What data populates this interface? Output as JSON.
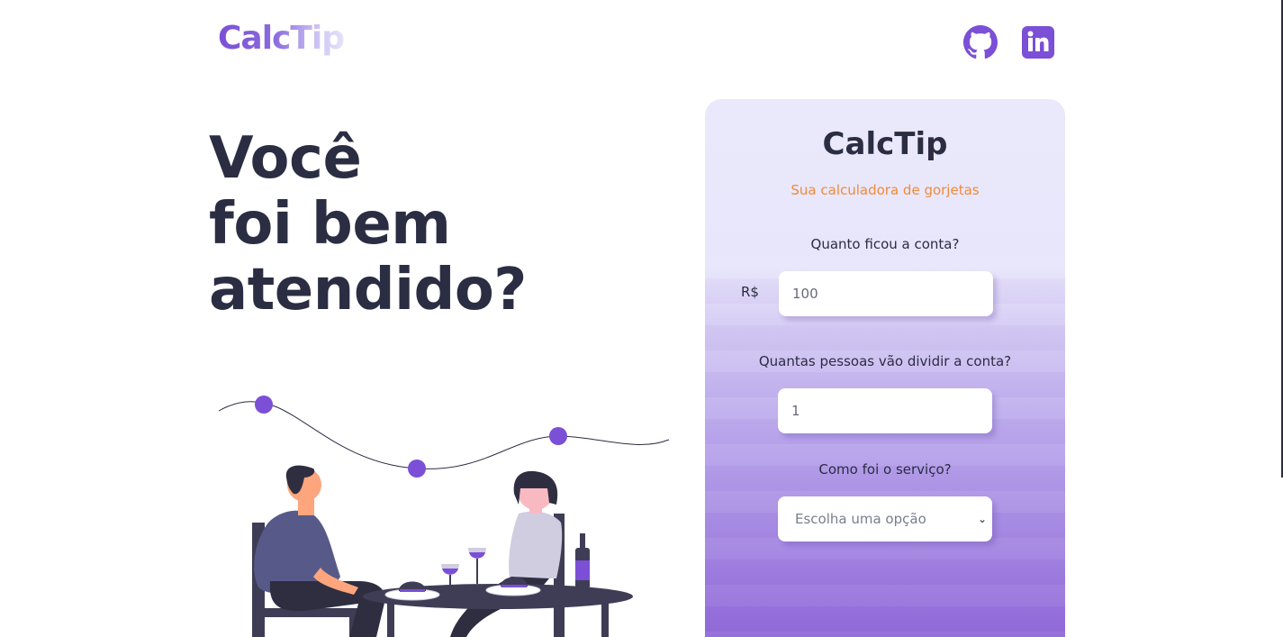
{
  "header": {
    "logo": "CalcTip",
    "social": [
      {
        "name": "github",
        "icon": "github-icon"
      },
      {
        "name": "linkedin",
        "icon": "linkedin-icon"
      }
    ],
    "icon_color": "#7b4fd6"
  },
  "hero": {
    "lines": [
      "Você",
      "foi bem",
      "atendido?"
    ]
  },
  "calculator": {
    "title": "CalcTip",
    "subtitle": "Sua calculadora de gorjetas",
    "bill": {
      "label": "Quanto ficou a conta?",
      "currency": "R$",
      "value": "100"
    },
    "people": {
      "label": "Quantas pessoas vão dividir a conta?",
      "value": "1"
    },
    "service": {
      "label": "Como foi o serviço?",
      "selected": "Escolha uma opção"
    }
  },
  "colors": {
    "accent": "#7b4fd6",
    "subtitle": "#f08a3c",
    "text": "#2b2d42"
  }
}
